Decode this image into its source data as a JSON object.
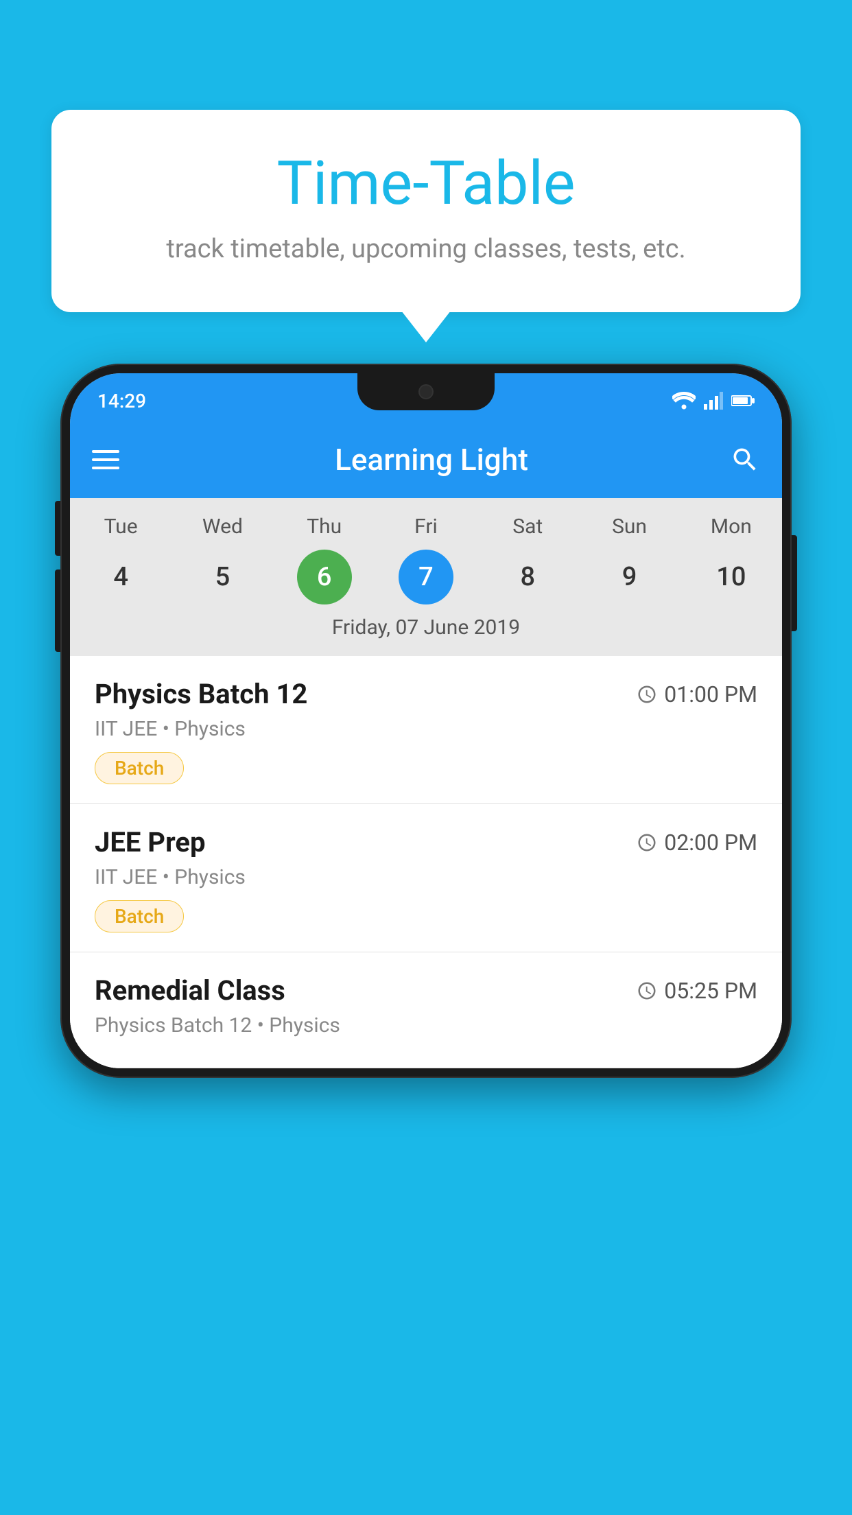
{
  "background_color": "#1ab8e8",
  "speech_bubble": {
    "title": "Time-Table",
    "subtitle": "track timetable, upcoming classes, tests, etc."
  },
  "phone": {
    "status_bar": {
      "time": "14:29"
    },
    "app_bar": {
      "title": "Learning Light"
    },
    "calendar": {
      "days_of_week": [
        "Tue",
        "Wed",
        "Thu",
        "Fri",
        "Sat",
        "Sun",
        "Mon"
      ],
      "dates": [
        "4",
        "5",
        "6",
        "7",
        "8",
        "9",
        "10"
      ],
      "today_index": 2,
      "selected_index": 3,
      "selected_label": "Friday, 07 June 2019"
    },
    "schedule_items": [
      {
        "title": "Physics Batch 12",
        "time": "01:00 PM",
        "meta": "IIT JEE • Physics",
        "tag": "Batch"
      },
      {
        "title": "JEE Prep",
        "time": "02:00 PM",
        "meta": "IIT JEE • Physics",
        "tag": "Batch"
      },
      {
        "title": "Remedial Class",
        "time": "05:25 PM",
        "meta": "Physics Batch 12 • Physics",
        "tag": ""
      }
    ]
  }
}
